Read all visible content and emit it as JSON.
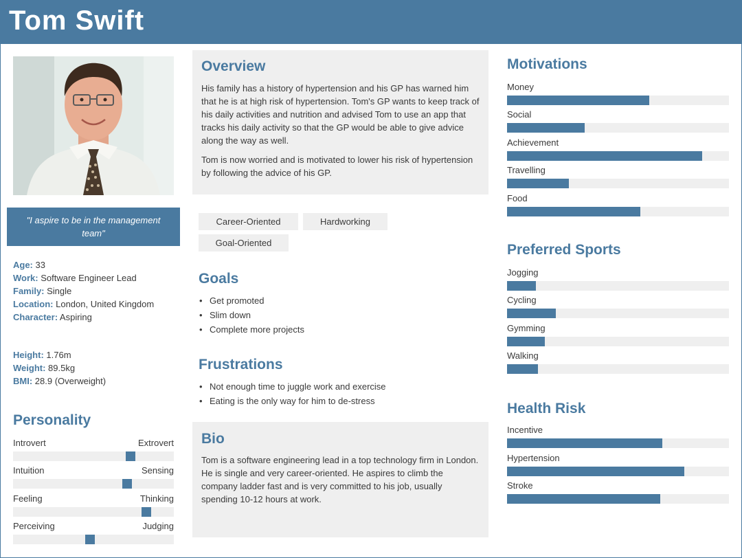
{
  "name": "Tom Swift",
  "quote": "\"I aspire to be in the management team\"",
  "profile": [
    {
      "label": "Age:",
      "value": " 33"
    },
    {
      "label": "Work:",
      "value": " Software Engineer Lead"
    },
    {
      "label": "Family:",
      "value": " Single"
    },
    {
      "label": "Location:",
      "value": " London, United Kingdom"
    },
    {
      "label": "Character:",
      "value": " Aspiring"
    }
  ],
  "body": [
    {
      "label": "Height:",
      "value": " 1.76m"
    },
    {
      "label": "Weight:",
      "value": " 89.5kg"
    },
    {
      "label": "BMI:",
      "value": " 28.9 (Overweight)"
    }
  ],
  "personality": {
    "title": "Personality",
    "traits": [
      {
        "left": "Introvert",
        "right": "Extrovert",
        "level": 0.73
      },
      {
        "left": "Intuition",
        "right": "Sensing",
        "level": 0.71
      },
      {
        "left": "Feeling",
        "right": "Thinking",
        "level": 0.83
      },
      {
        "left": "Perceiving",
        "right": "Judging",
        "level": 0.48
      }
    ]
  },
  "overview": {
    "title": "Overview",
    "paragraphs": [
      "His family has a history of hypertension and his GP has warned him that he is at high risk of hypertension. Tom's GP wants to keep track of his daily activities and nutrition and advised Tom to use an app that tracks his daily activity so that the GP would be able to give advice along the way as well.",
      "Tom is now worried and is motivated to lower his risk of hypertension by following the advice of his GP."
    ]
  },
  "tags": [
    "Career-Oriented",
    "Hardworking",
    "Goal-Oriented"
  ],
  "goals": {
    "title": "Goals",
    "items": [
      "Get promoted",
      "Slim down",
      "Complete more projects"
    ]
  },
  "frustrations": {
    "title": "Frustrations",
    "items": [
      "Not enough time to juggle work and exercise",
      "Eating is the only way for him to de-stress"
    ]
  },
  "bio": {
    "title": "Bio",
    "text": "Tom is a software engineering lead in a top technology firm in London. He is single and very career-oriented. He aspires to climb the company ladder fast and is very committed to his job, usually spending 10-12 hours at work."
  },
  "motivations": {
    "title": "Motivations",
    "items": [
      {
        "label": "Money",
        "value": 0.64
      },
      {
        "label": "Social",
        "value": 0.35
      },
      {
        "label": "Achievement",
        "value": 0.88
      },
      {
        "label": "Travelling",
        "value": 0.28
      },
      {
        "label": "Food",
        "value": 0.6
      }
    ]
  },
  "sports": {
    "title": "Preferred Sports",
    "items": [
      {
        "label": "Jogging",
        "value": 0.13
      },
      {
        "label": "Cycling",
        "value": 0.22
      },
      {
        "label": "Gymming",
        "value": 0.17
      },
      {
        "label": "Walking",
        "value": 0.14
      }
    ]
  },
  "health_risk": {
    "title": "Health Risk",
    "items": [
      {
        "label": "Incentive",
        "value": 0.7
      },
      {
        "label": "Hypertension",
        "value": 0.8
      },
      {
        "label": "Stroke",
        "value": 0.69
      }
    ]
  },
  "colors": {
    "accent": "#4a7aa0",
    "panel": "#efefef",
    "text": "#3a3a3a"
  }
}
